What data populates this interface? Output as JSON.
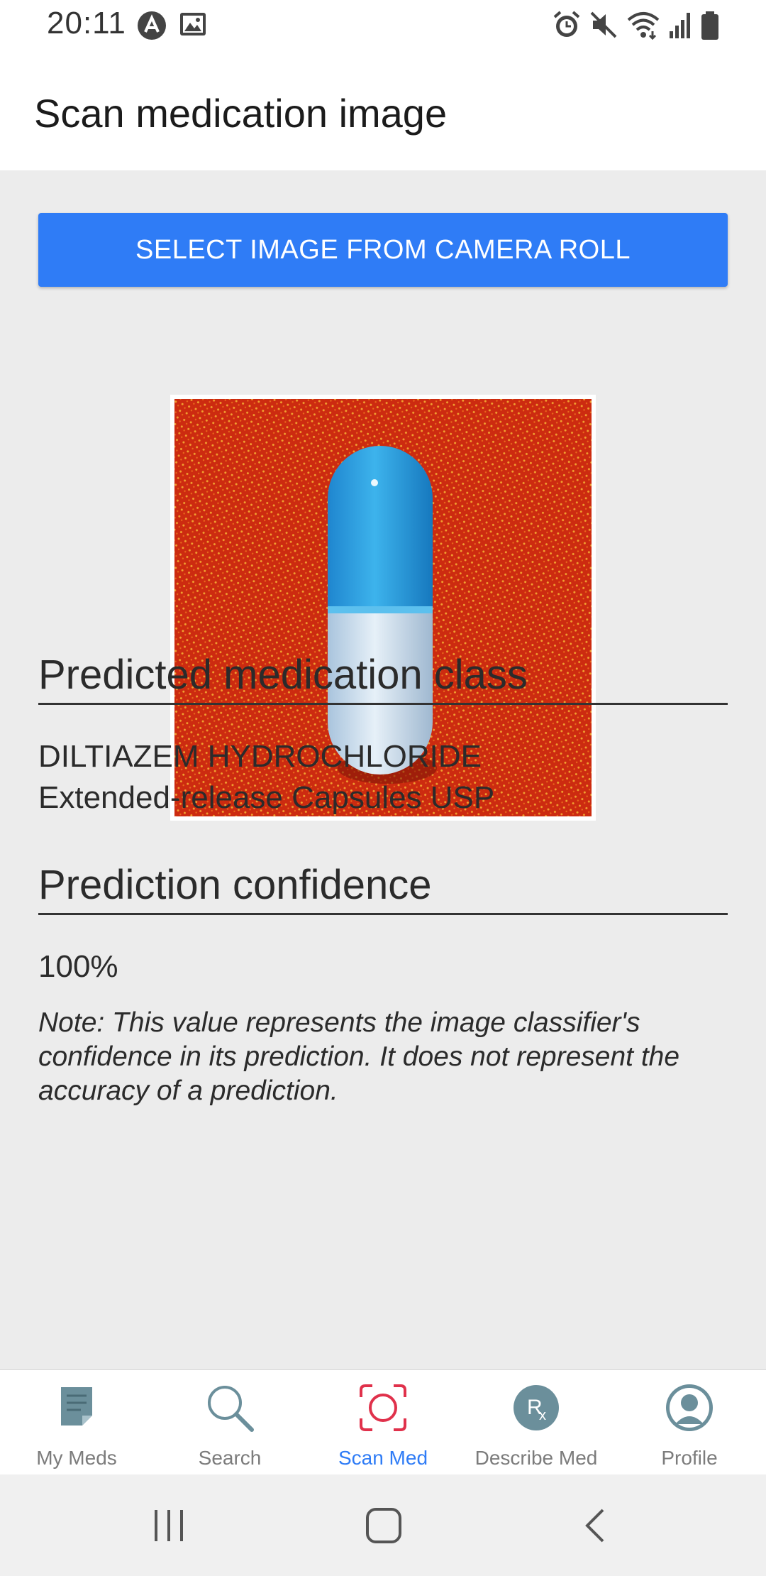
{
  "status_bar": {
    "time": "20:11",
    "left_icons": [
      "notification-a-icon",
      "image-icon"
    ],
    "right_icons": [
      "alarm-icon",
      "mute-icon",
      "wifi-icon",
      "signal-icon",
      "battery-icon"
    ]
  },
  "header": {
    "title": "Scan medication image"
  },
  "main": {
    "select_button_label": "SELECT IMAGE FROM CAMERA ROLL",
    "select_button_color": "#2f7cf6",
    "prediction_heading": "Predicted medication class",
    "prediction_line1": "DILTIAZEM HYDROCHLORIDE",
    "prediction_line2": "Extended-release Capsules USP",
    "confidence_heading": "Prediction confidence",
    "confidence_value": "100%",
    "note_line1": "Note: This value represents the image classifier's",
    "note_line2": "confidence in its prediction. It does not represent the",
    "note_line3": "accuracy of a prediction."
  },
  "tabs": [
    {
      "label": "My Meds",
      "icon": "notes-icon",
      "active": false
    },
    {
      "label": "Search",
      "icon": "search-icon",
      "active": false
    },
    {
      "label": "Scan Med",
      "icon": "scan-icon",
      "active": true
    },
    {
      "label": "Describe Med",
      "icon": "rx-icon",
      "active": false
    },
    {
      "label": "Profile",
      "icon": "profile-icon",
      "active": false
    }
  ],
  "colors": {
    "accent": "#2f7cf6",
    "scan_icon": "#e0314b",
    "tab_inactive": "#7c7c7c"
  },
  "nav_bar": {
    "buttons": [
      "recents-icon",
      "home-icon",
      "back-icon"
    ]
  }
}
